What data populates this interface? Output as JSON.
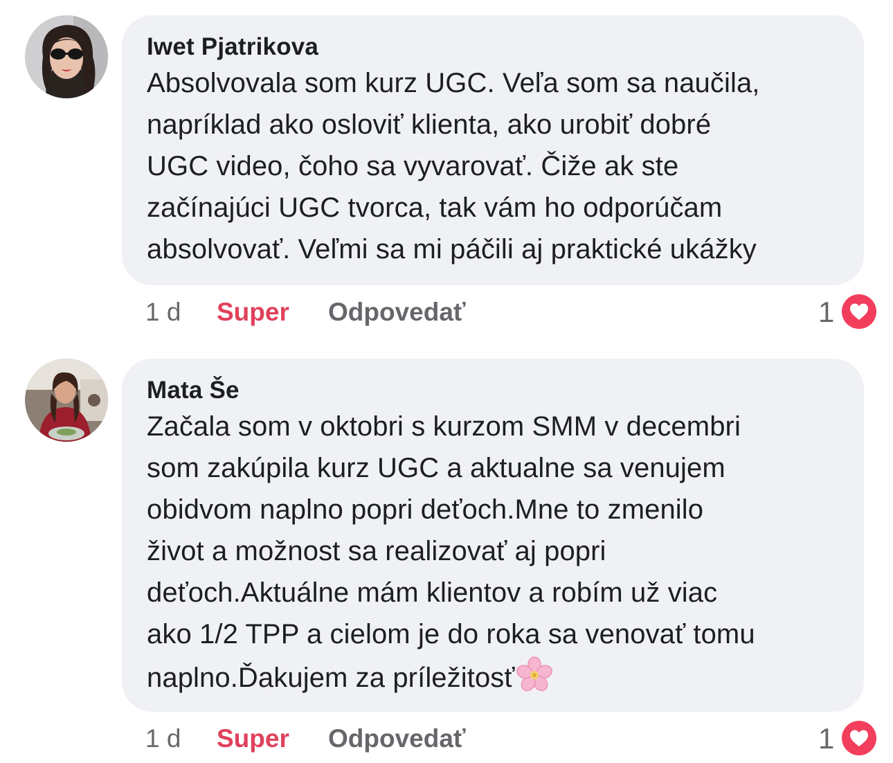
{
  "comments": [
    {
      "author": "Iwet Pjatrikova",
      "text": "Absolvovala som kurz UGC. Veľa som sa naučila,\nnapríklad ako osloviť klienta, ako urobiť dobré\nUGC video, čoho sa vyvarovať. Čiže ak ste\nzačínajúci UGC tvorca, tak vám ho odporúčam\nabsolvovať. Veľmi sa mi páčili aj praktické ukážky",
      "time": "1 d",
      "like_label": "Super",
      "reply_label": "Odpovedať",
      "reaction_count": "1",
      "reaction_icon": "heart-icon"
    },
    {
      "author": "Mata Še",
      "text": "Začala som v oktobri s kurzom  SMM v decembri\nsom zakúpila kurz UGC a aktualne sa venujem\nobidvom naplno popri deťoch.Mne to zmenilo\nživot a možnost sa realizovať aj popri\ndeťoch.Aktuálne mám klientov a robím už viac\nako 1/2 TPP a cielom je do roka sa venovať tomu\nnaplno.Ďakujem za príležitosť",
      "text_emoji": "cherry-blossom-icon",
      "time": "1 d",
      "like_label": "Super",
      "reply_label": "Odpovedať",
      "reaction_count": "1",
      "reaction_icon": "heart-icon"
    }
  ],
  "colors": {
    "bubble": "#f0f1f4",
    "text": "#1c1e21",
    "meta": "#65676b",
    "like_active": "#e0415b",
    "heart": "#f23e5c"
  }
}
